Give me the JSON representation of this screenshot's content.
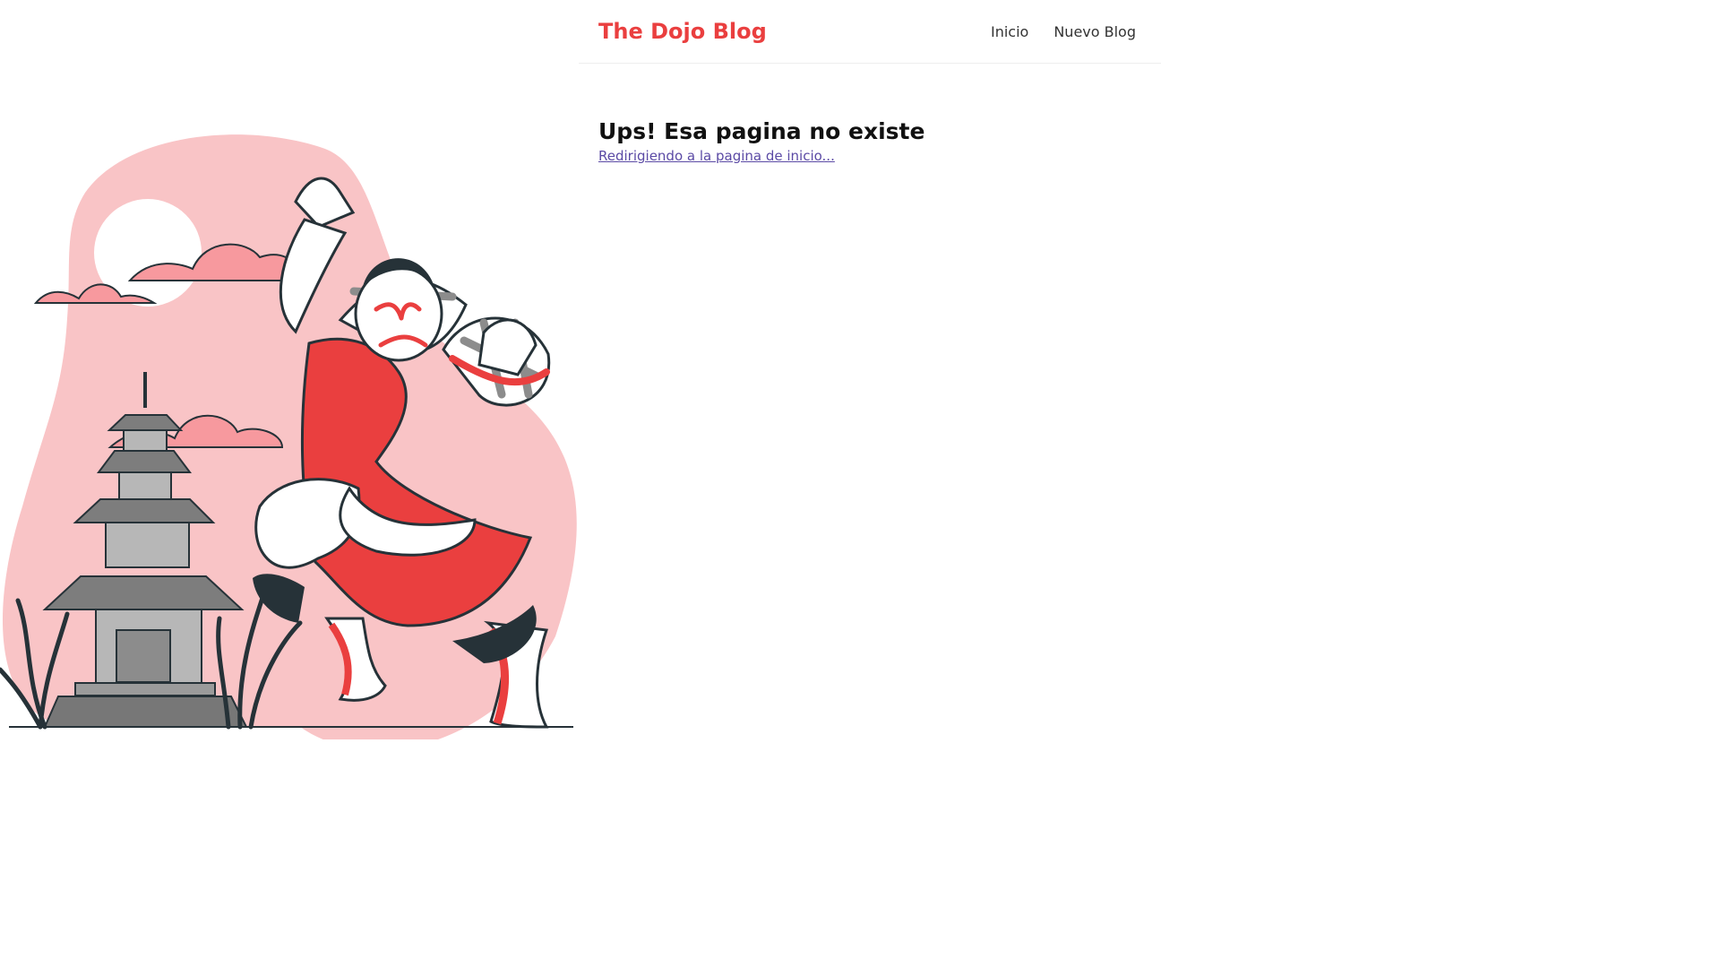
{
  "navbar": {
    "brand": "The Dojo Blog",
    "links": [
      {
        "label": "Inicio"
      },
      {
        "label": "Nuevo Blog"
      }
    ]
  },
  "not_found": {
    "title": "Ups! Esa pagina no existe",
    "redirect_link": "Redirigiendo a la pagina de inicio..."
  },
  "illustration": {
    "icon": "kabuki-dancer-pagoda-illustration",
    "colors": {
      "background_blob": "#f9c4c6",
      "cloud": "#f7999e",
      "costume_red": "#ea3f3f",
      "dark_outline": "#263238",
      "pagoda_gray": "#8c8c8c",
      "white": "#ffffff"
    }
  }
}
